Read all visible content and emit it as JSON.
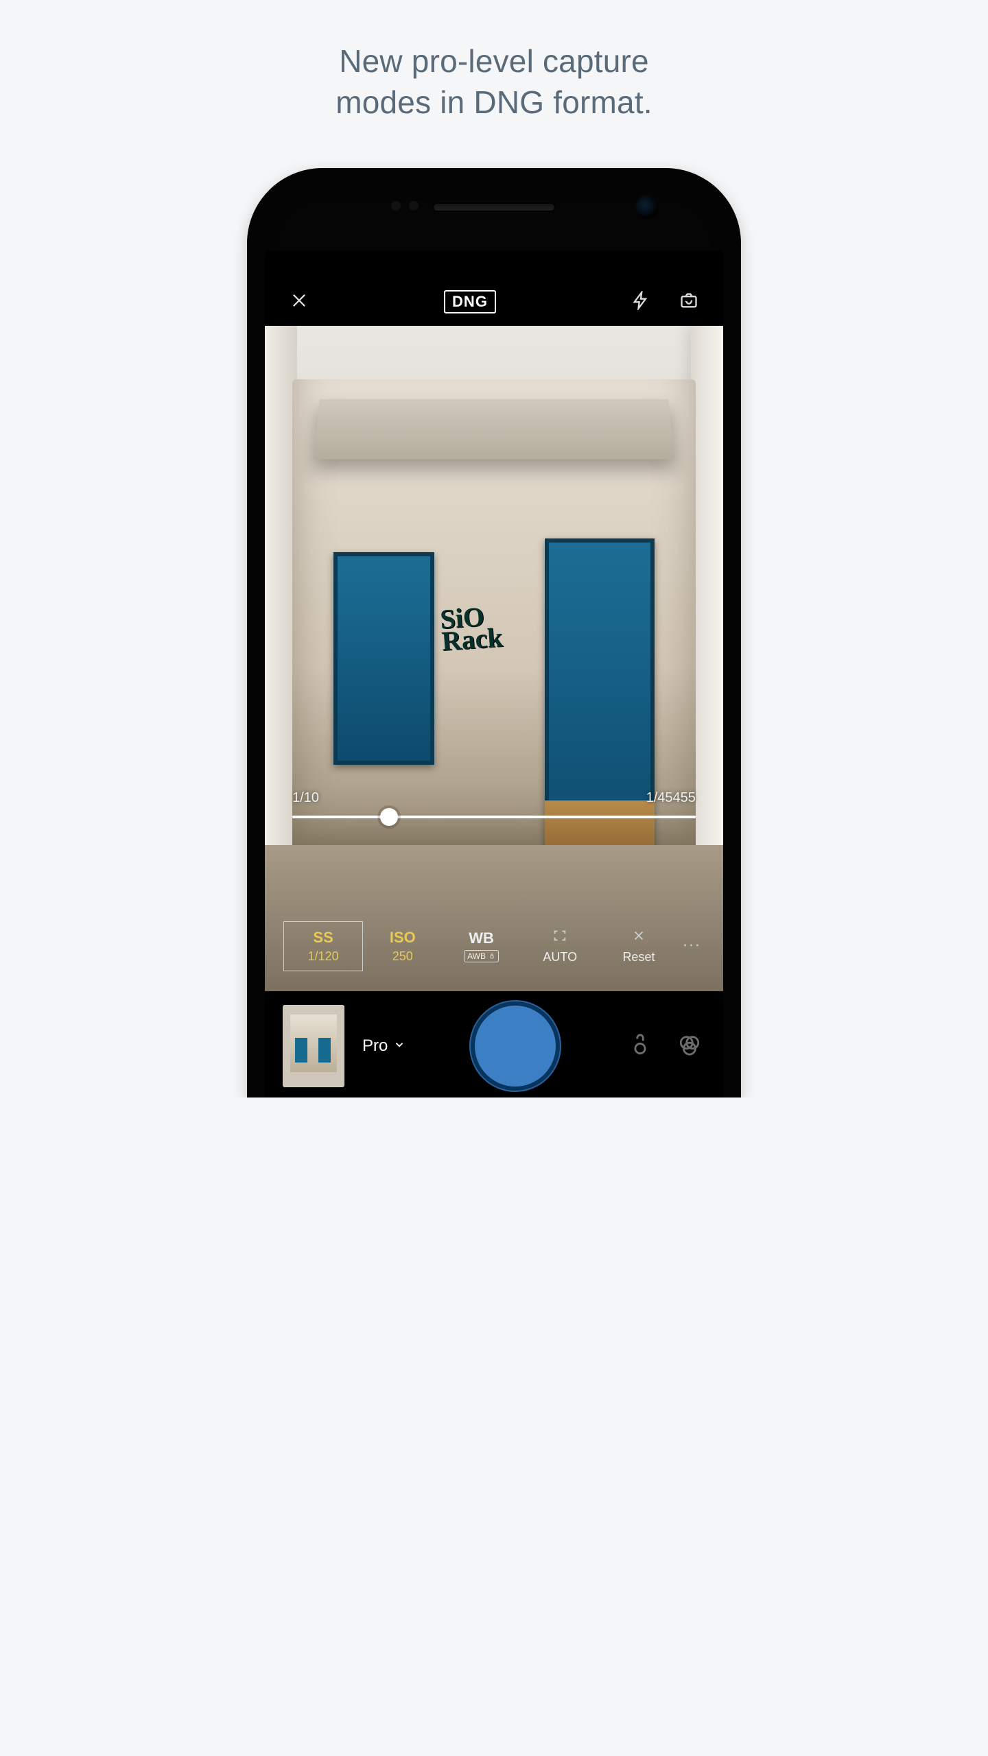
{
  "promo": {
    "headline_line1": "New pro-level capture",
    "headline_line2": "modes in DNG format."
  },
  "camera": {
    "top": {
      "format_badge": "DNG"
    },
    "slider": {
      "min_label": "1/10",
      "max_label": "1/45455",
      "thumb_pct": 24
    },
    "params": {
      "ss": {
        "title": "SS",
        "value": "1/120"
      },
      "iso": {
        "title": "ISO",
        "value": "250"
      },
      "wb": {
        "title": "WB",
        "value_chip": "AWB"
      },
      "focus": {
        "title": "",
        "value": "AUTO"
      },
      "reset": {
        "title": "✕",
        "value": "Reset"
      }
    },
    "bottom": {
      "mode_label": "Pro"
    }
  }
}
